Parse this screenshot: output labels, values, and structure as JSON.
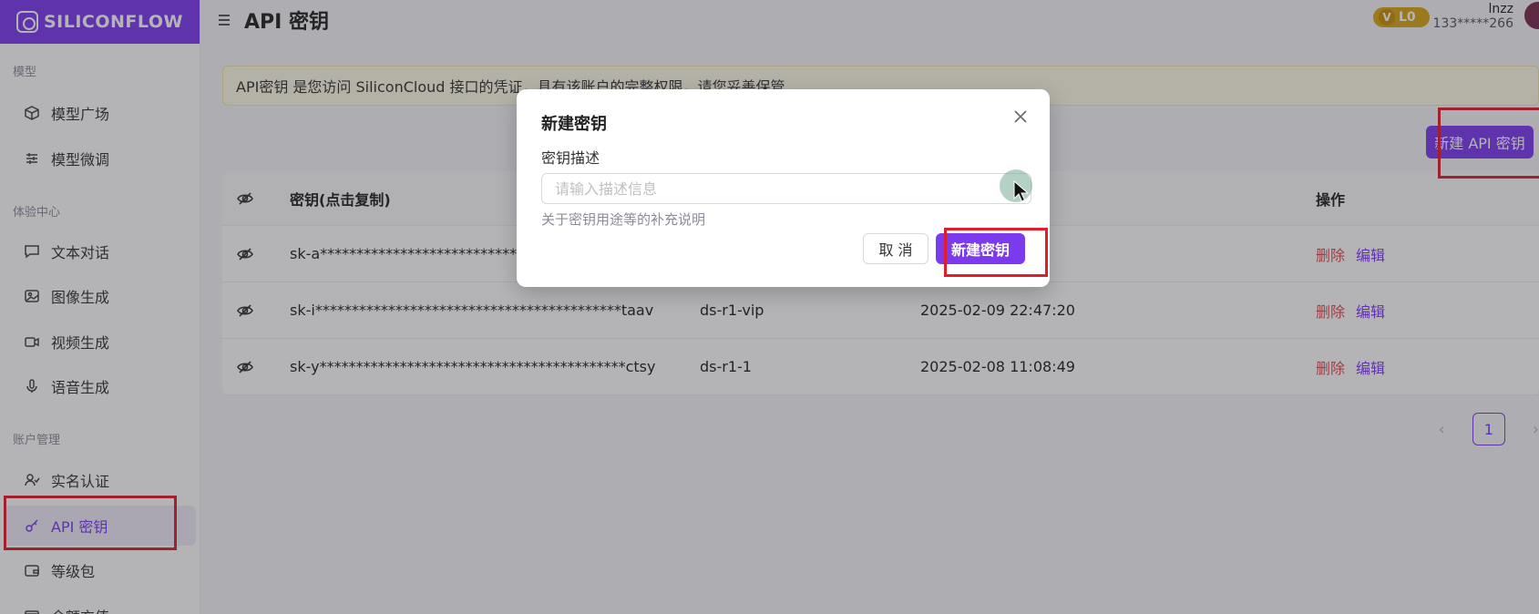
{
  "brand": {
    "name": "SILICONFLOW"
  },
  "header": {
    "title": "API 密钥",
    "user_name": "lnzz",
    "user_phone": "133*****266",
    "level": "L0",
    "level_icon": "V"
  },
  "sidebar": {
    "sections": [
      {
        "title": "模型",
        "items": [
          {
            "label": "模型广场",
            "icon": "cube-icon"
          },
          {
            "label": "模型微调",
            "icon": "sliders-icon"
          }
        ]
      },
      {
        "title": "体验中心",
        "items": [
          {
            "label": "文本对话",
            "icon": "chat-icon"
          },
          {
            "label": "图像生成",
            "icon": "image-icon"
          },
          {
            "label": "视频生成",
            "icon": "video-icon"
          },
          {
            "label": "语音生成",
            "icon": "mic-icon"
          }
        ]
      },
      {
        "title": "账户管理",
        "items": [
          {
            "label": "实名认证",
            "icon": "user-check-icon"
          },
          {
            "label": "API 密钥",
            "icon": "key-icon",
            "active": true
          },
          {
            "label": "等级包",
            "icon": "wallet-icon"
          },
          {
            "label": "余额充值",
            "icon": "card-icon"
          }
        ]
      }
    ]
  },
  "notice": "API密钥 是您访问 SiliconCloud 接口的凭证，具有该账户的完整权限，请您妥善保管",
  "toolbar": {
    "new_key_label": "新建 API 密钥"
  },
  "table": {
    "headers": {
      "key": "密钥(点击复制)",
      "ops": "操作"
    },
    "rows": [
      {
        "key": "sk-a*****************************************",
        "name": "",
        "time": "",
        "delete": "删除",
        "edit": "编辑"
      },
      {
        "key": "sk-i******************************************taav",
        "name": "ds-r1-vip",
        "time": "2025-02-09 22:47:20",
        "delete": "删除",
        "edit": "编辑"
      },
      {
        "key": "sk-y******************************************ctsy",
        "name": "ds-r1-1",
        "time": "2025-02-08 11:08:49",
        "delete": "删除",
        "edit": "编辑"
      }
    ]
  },
  "pagination": {
    "current": "1",
    "prev": "‹",
    "next": "›"
  },
  "dialog": {
    "title": "新建密钥",
    "label": "密钥描述",
    "placeholder": "请输入描述信息",
    "value": "",
    "help": "关于密钥用途等的补充说明",
    "cancel": "取 消",
    "ok": "新建密钥"
  },
  "colors": {
    "brand": "#7c3aed",
    "danger": "#e5484d",
    "highlight": "#e11d2a",
    "badge": "#d9a515"
  }
}
